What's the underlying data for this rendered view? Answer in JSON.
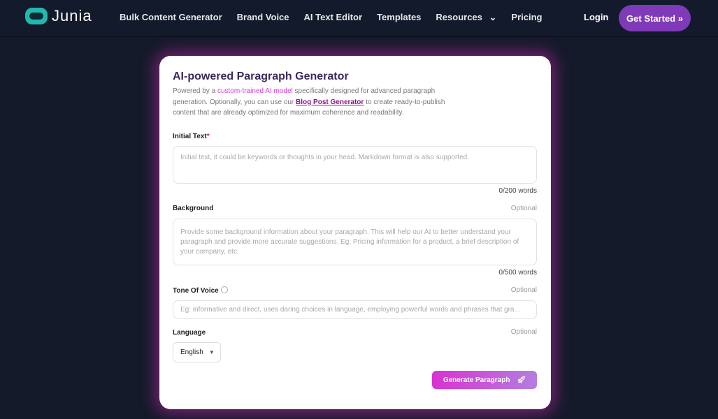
{
  "nav": {
    "brand": "Junia",
    "links": [
      "Bulk Content Generator",
      "Brand Voice",
      "AI Text Editor",
      "Templates",
      "Resources",
      "Pricing"
    ],
    "login": "Login",
    "cta": "Get Started"
  },
  "card": {
    "title": "AI-powered Paragraph Generator",
    "desc_1": "Powered by a ",
    "desc_hl": "custom-trained AI model",
    "desc_2": " specifically designed for advanced paragraph generation. Optionally, you can use our ",
    "desc_link": "Blog Post Generator",
    "desc_3": " to create ready-to-publish content that are already optimized for maximum coherence and readability.",
    "initial_label": "Initial Text",
    "required": "*",
    "initial_placeholder": "Initial text, it could be keywords or thoughts in your head. Markdown format is also supported.",
    "initial_count": "0/200 words",
    "bg_label": "Background",
    "optional": "Optional",
    "bg_placeholder": "Provide some background information about your paragraph. This will help our AI to better understand your paragraph and provide more accurate suggestions. Eg: Pricing information for a product, a brief description of your company, etc.",
    "bg_count": "0/500 words",
    "tone_label": "Tone Of Voice",
    "tone_placeholder": "Eg: informative and direct, uses daring choices in language, employing powerful words and phrases that gra...",
    "lang_label": "Language",
    "lang_value": "English",
    "generate": "Generate Paragraph"
  }
}
